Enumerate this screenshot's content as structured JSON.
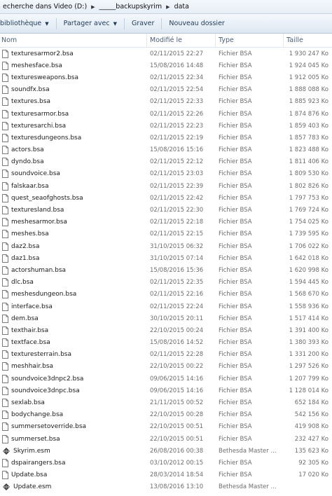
{
  "breadcrumb": [
    "echerche dans Video (D:)",
    "_____backupskyrim",
    "data"
  ],
  "toolbar": {
    "library": "bibliothèque",
    "share": "Partager avec",
    "burn": "Graver",
    "new_folder": "Nouveau dossier"
  },
  "columns": {
    "name": "Nom",
    "date": "Modifié le",
    "type": "Type",
    "size": "Taille"
  },
  "files": [
    {
      "name": "texturesarmor2.bsa",
      "date": "02/11/2015 22:27",
      "type": "Fichier BSA",
      "size": "1 930 247 Ko",
      "icon": "file-icon"
    },
    {
      "name": "meshesface.bsa",
      "date": "15/08/2016 14:48",
      "type": "Fichier BSA",
      "size": "1 924 045 Ko",
      "icon": "file-icon"
    },
    {
      "name": "texturesweapons.bsa",
      "date": "02/11/2015 22:34",
      "type": "Fichier BSA",
      "size": "1 912 005 Ko",
      "icon": "file-icon"
    },
    {
      "name": "soundfx.bsa",
      "date": "02/11/2015 22:54",
      "type": "Fichier BSA",
      "size": "1 888 088 Ko",
      "icon": "file-icon"
    },
    {
      "name": "textures.bsa",
      "date": "02/11/2015 22:33",
      "type": "Fichier BSA",
      "size": "1 885 923 Ko",
      "icon": "file-icon"
    },
    {
      "name": "texturesarmor.bsa",
      "date": "02/11/2015 22:26",
      "type": "Fichier BSA",
      "size": "1 874 876 Ko",
      "icon": "file-icon"
    },
    {
      "name": "texturesarchi.bsa",
      "date": "02/11/2015 22:23",
      "type": "Fichier BSA",
      "size": "1 859 403 Ko",
      "icon": "file-icon"
    },
    {
      "name": "texturesdungeons.bsa",
      "date": "02/11/2015 22:19",
      "type": "Fichier BSA",
      "size": "1 857 783 Ko",
      "icon": "file-icon"
    },
    {
      "name": "actors.bsa",
      "date": "15/08/2016 15:16",
      "type": "Fichier BSA",
      "size": "1 823 488 Ko",
      "icon": "file-icon"
    },
    {
      "name": "dyndo.bsa",
      "date": "02/11/2015 22:12",
      "type": "Fichier BSA",
      "size": "1 811 406 Ko",
      "icon": "file-icon"
    },
    {
      "name": "soundvoice.bsa",
      "date": "02/11/2015 23:03",
      "type": "Fichier BSA",
      "size": "1 809 530 Ko",
      "icon": "file-icon"
    },
    {
      "name": "falskaar.bsa",
      "date": "02/11/2015 22:39",
      "type": "Fichier BSA",
      "size": "1 802 826 Ko",
      "icon": "file-icon"
    },
    {
      "name": "quest_seaofghosts.bsa",
      "date": "02/11/2015 22:42",
      "type": "Fichier BSA",
      "size": "1 797 753 Ko",
      "icon": "file-icon"
    },
    {
      "name": "texturesland.bsa",
      "date": "02/11/2015 22:30",
      "type": "Fichier BSA",
      "size": "1 769 724 Ko",
      "icon": "file-icon"
    },
    {
      "name": "meshesarmor.bsa",
      "date": "02/11/2015 22:18",
      "type": "Fichier BSA",
      "size": "1 754 025 Ko",
      "icon": "file-icon"
    },
    {
      "name": "meshes.bsa",
      "date": "02/11/2015 22:15",
      "type": "Fichier BSA",
      "size": "1 739 595 Ko",
      "icon": "file-icon"
    },
    {
      "name": "daz2.bsa",
      "date": "31/10/2015 06:32",
      "type": "Fichier BSA",
      "size": "1 706 022 Ko",
      "icon": "file-icon"
    },
    {
      "name": "daz1.bsa",
      "date": "31/10/2015 07:14",
      "type": "Fichier BSA",
      "size": "1 642 018 Ko",
      "icon": "file-icon"
    },
    {
      "name": "actorshuman.bsa",
      "date": "15/08/2016 15:36",
      "type": "Fichier BSA",
      "size": "1 620 998 Ko",
      "icon": "file-icon"
    },
    {
      "name": "dlc.bsa",
      "date": "02/11/2015 22:35",
      "type": "Fichier BSA",
      "size": "1 594 445 Ko",
      "icon": "file-icon"
    },
    {
      "name": "meshesdungeon.bsa",
      "date": "02/11/2015 22:16",
      "type": "Fichier BSA",
      "size": "1 568 670 Ko",
      "icon": "file-icon"
    },
    {
      "name": "interface.bsa",
      "date": "02/11/2015 22:24",
      "type": "Fichier BSA",
      "size": "1 558 936 Ko",
      "icon": "file-icon"
    },
    {
      "name": "dem.bsa",
      "date": "30/10/2015 20:11",
      "type": "Fichier BSA",
      "size": "1 517 414 Ko",
      "icon": "file-icon"
    },
    {
      "name": "texthair.bsa",
      "date": "22/10/2015 00:24",
      "type": "Fichier BSA",
      "size": "1 391 400 Ko",
      "icon": "file-icon"
    },
    {
      "name": "textface.bsa",
      "date": "15/08/2016 14:52",
      "type": "Fichier BSA",
      "size": "1 380 393 Ko",
      "icon": "file-icon"
    },
    {
      "name": "texturesterrain.bsa",
      "date": "02/11/2015 22:28",
      "type": "Fichier BSA",
      "size": "1 331 200 Ko",
      "icon": "file-icon"
    },
    {
      "name": "meshhair.bsa",
      "date": "22/10/2015 00:22",
      "type": "Fichier BSA",
      "size": "1 297 526 Ko",
      "icon": "file-icon"
    },
    {
      "name": "soundvoice3dnpc2.bsa",
      "date": "09/06/2015 14:16",
      "type": "Fichier BSA",
      "size": "1 207 799 Ko",
      "icon": "file-icon"
    },
    {
      "name": "soundvoice3dnpc.bsa",
      "date": "09/06/2015 14:16",
      "type": "Fichier BSA",
      "size": "1 128 014 Ko",
      "icon": "file-icon"
    },
    {
      "name": "sexlab.bsa",
      "date": "21/11/2015 00:52",
      "type": "Fichier BSA",
      "size": "652 184 Ko",
      "icon": "file-icon"
    },
    {
      "name": "bodychange.bsa",
      "date": "22/10/2015 00:28",
      "type": "Fichier BSA",
      "size": "542 156 Ko",
      "icon": "file-icon"
    },
    {
      "name": "summersetoverride.bsa",
      "date": "22/10/2015 00:51",
      "type": "Fichier BSA",
      "size": "419 908 Ko",
      "icon": "file-icon"
    },
    {
      "name": "summerset.bsa",
      "date": "22/10/2015 00:51",
      "type": "Fichier BSA",
      "size": "232 427 Ko",
      "icon": "file-icon"
    },
    {
      "name": "Skyrim.esm",
      "date": "26/08/2016 00:38",
      "type": "Bethesda Master ...",
      "size": "135 623 Ko",
      "icon": "esm-icon"
    },
    {
      "name": "dspairangers.bsa",
      "date": "03/10/2012 00:15",
      "type": "Fichier BSA",
      "size": "92 305 Ko",
      "icon": "file-icon"
    },
    {
      "name": "Update.bsa",
      "date": "28/03/2014 18:54",
      "type": "Fichier BSA",
      "size": "17 020 Ko",
      "icon": "file-icon"
    },
    {
      "name": "Update.esm",
      "date": "13/08/2016 13:10",
      "type": "Bethesda Master ...",
      "size": "",
      "icon": "esm-icon"
    }
  ]
}
